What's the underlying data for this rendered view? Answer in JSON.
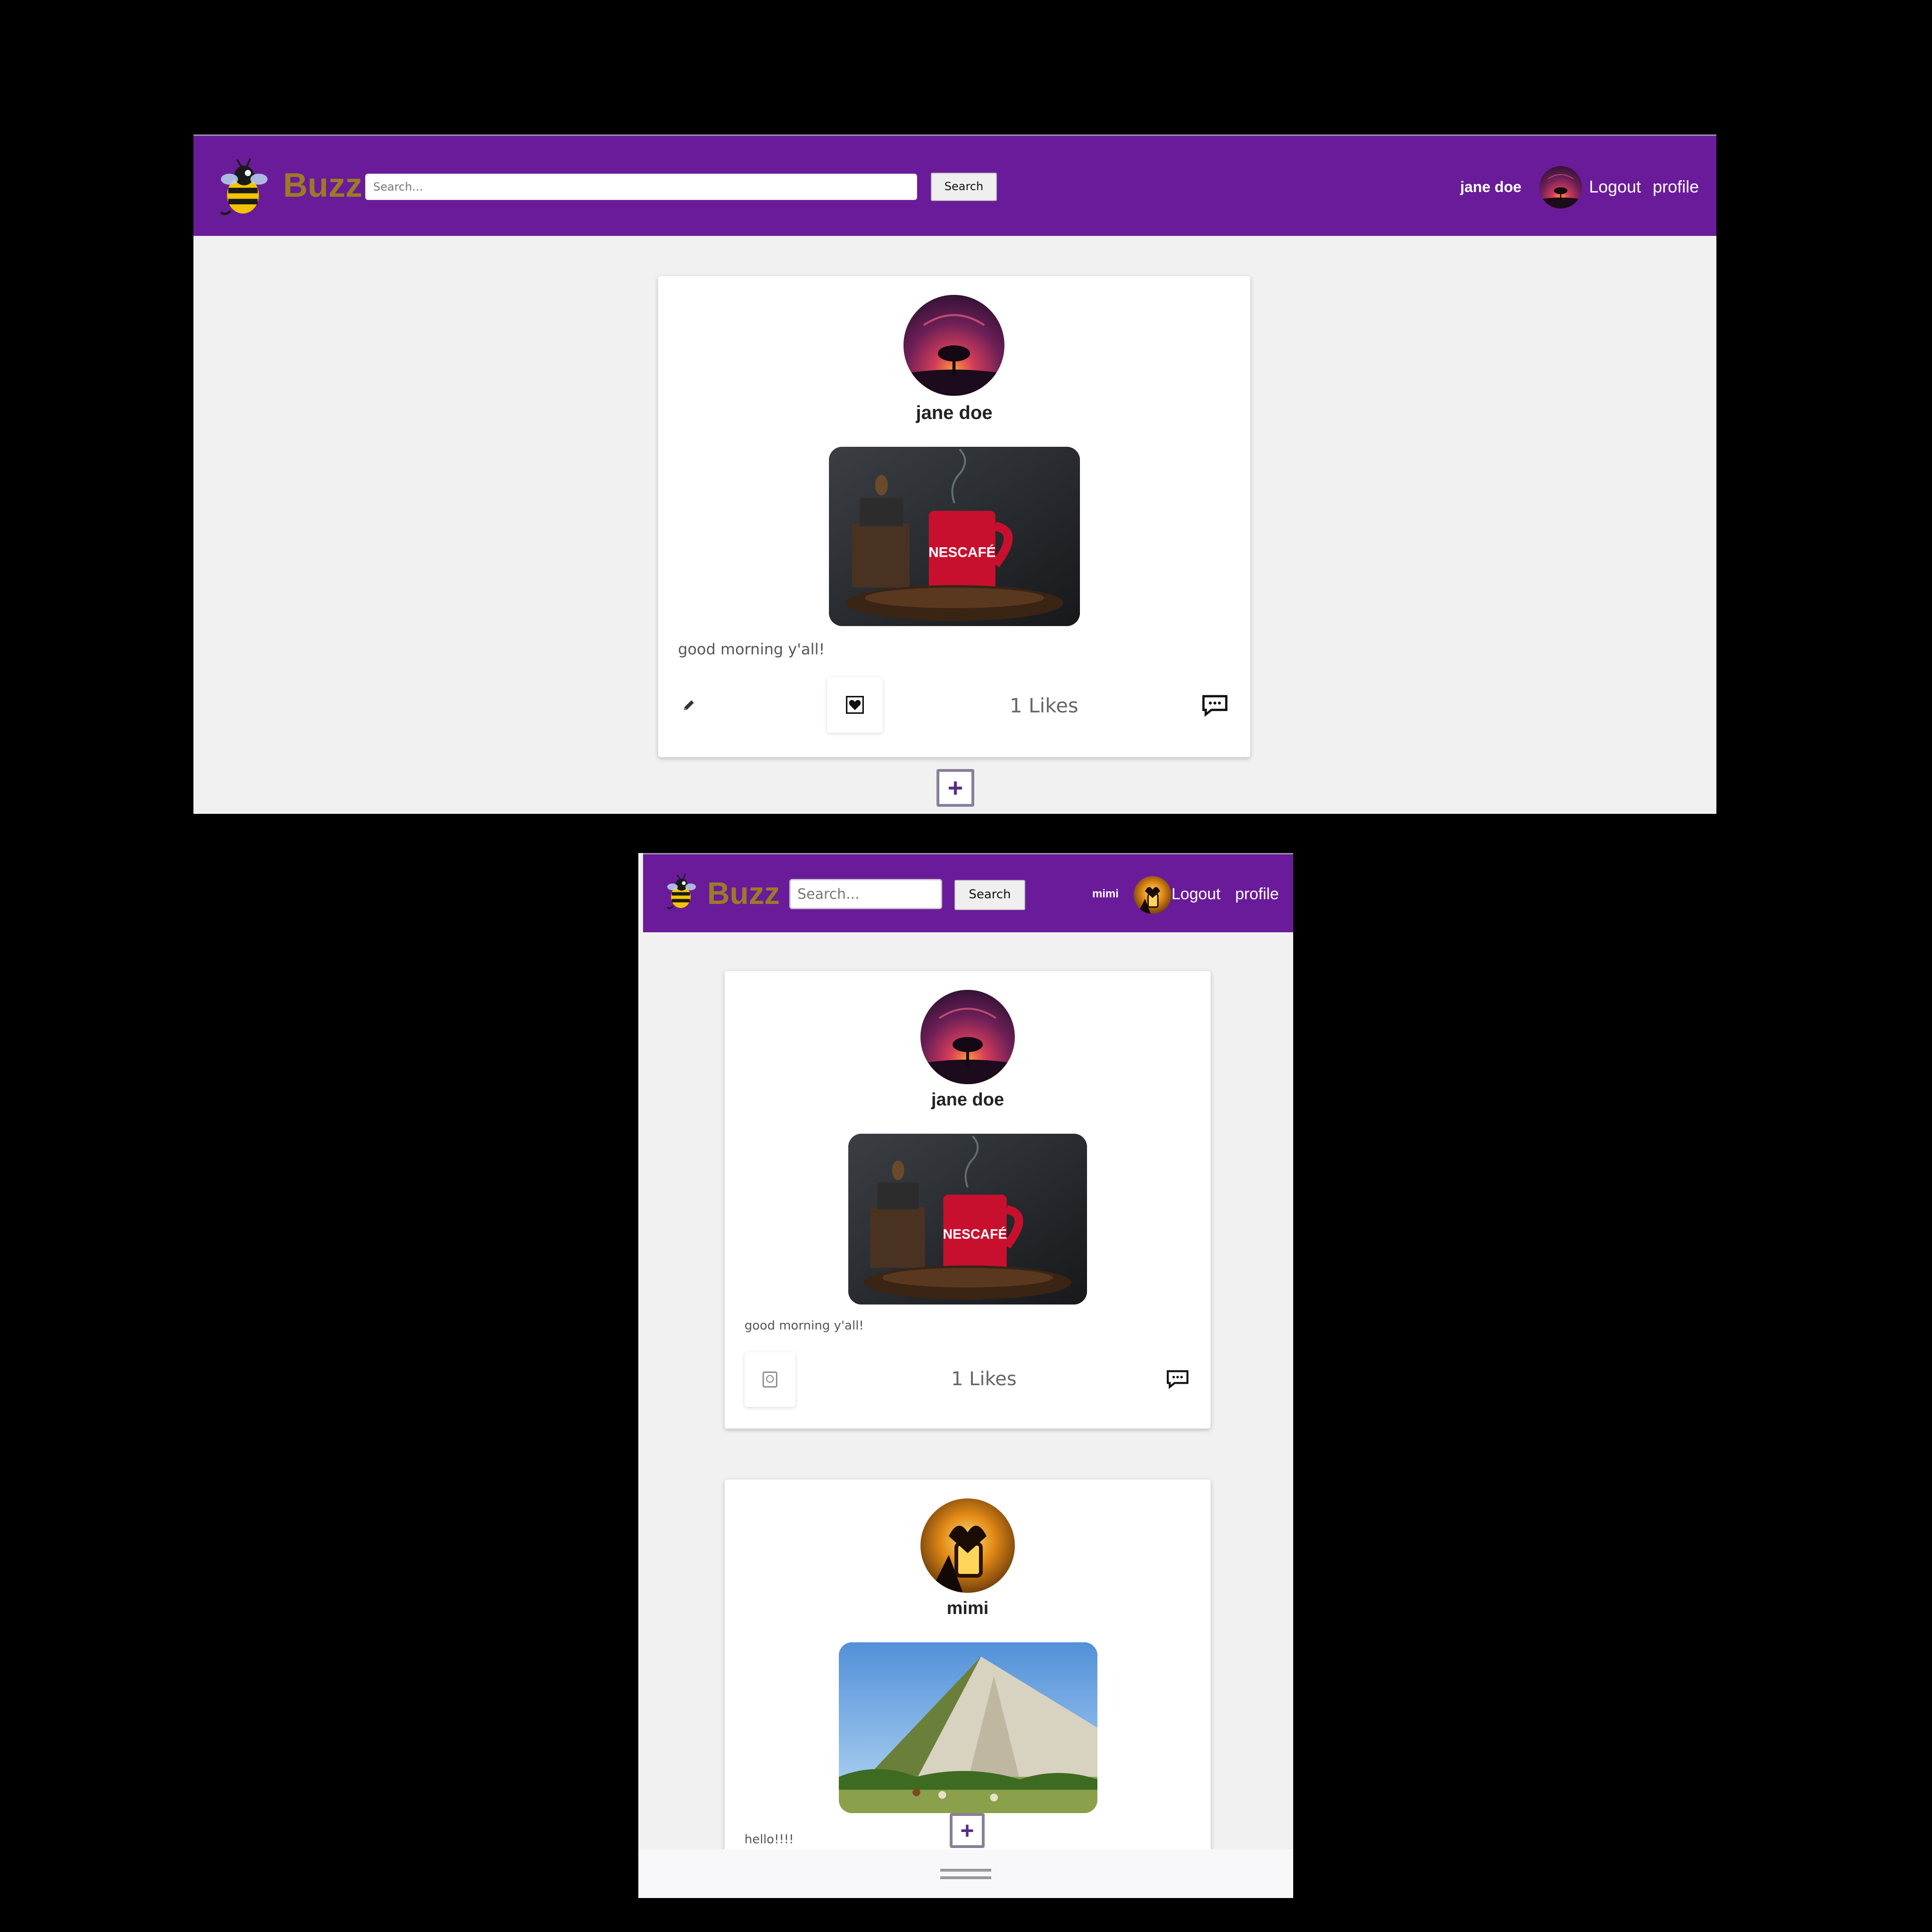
{
  "desktop": {
    "navbar": {
      "brand": "Buzz",
      "search_placeholder": "Search...",
      "search_button": "Search",
      "username": "jane doe",
      "logout": "Logout",
      "profile": "profile"
    },
    "post": {
      "author": "jane doe",
      "caption": "good morning y'all!",
      "likes": "1 Likes"
    },
    "fab_label": "+"
  },
  "mobile": {
    "navbar": {
      "brand": "Buzz",
      "search_placeholder": "Search...",
      "search_button": "Search",
      "username": "mimi",
      "logout": "Logout",
      "profile": "profile"
    },
    "posts": [
      {
        "author": "jane doe",
        "caption": "good morning y'all!",
        "likes": "1 Likes"
      },
      {
        "author": "mimi",
        "caption": "hello!!!!"
      }
    ],
    "fab_label": "+"
  },
  "colors": {
    "navbar": "#6a1b9a",
    "brand": "#9c7b26",
    "content_bg": "#f1f1f1"
  },
  "icons": [
    "bee-logo-icon",
    "pencil-icon",
    "heart-icon",
    "comment-icon",
    "plus-icon"
  ]
}
